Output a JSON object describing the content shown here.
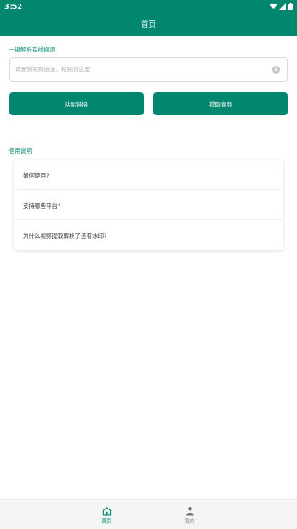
{
  "status_bar": {
    "time": "3:52"
  },
  "app_bar": {
    "title": "首页"
  },
  "parse_section": {
    "label": "一键解析在线视频",
    "search_placeholder": "请复制视频链接，粘贴到这里",
    "search_value": ""
  },
  "buttons": {
    "paste_label": "粘贴链接",
    "extract_label": "提取视频"
  },
  "tutorial_section": {
    "label": "使用说明",
    "items": [
      {
        "label": "如何使用?"
      },
      {
        "label": "支持哪些平台?"
      },
      {
        "label": "为什么视频提取解析了还有水印?"
      }
    ]
  },
  "bottom_nav": {
    "items": [
      {
        "label": "首页",
        "icon": "home-icon",
        "active": true
      },
      {
        "label": "我的",
        "icon": "person-icon",
        "active": false
      }
    ]
  },
  "colors": {
    "primary": "#00876e",
    "nav_inactive": "#8a8a8a",
    "background": "#ffffff"
  }
}
